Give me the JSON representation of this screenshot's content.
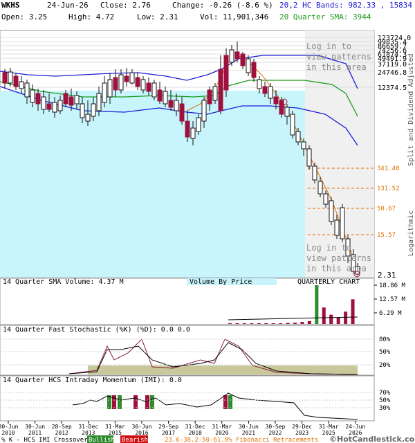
{
  "header": {
    "symbol": "WKHS",
    "date": "24-Jun-26",
    "close": "Close: 2.76",
    "change": "Change: -0.26 (-8.6 %)",
    "open": "Open: 3.25",
    "high": "High: 4.72",
    "low": "Low: 2.31",
    "vol": "Vol: 11,901,346",
    "bands": "20,2 HC Bands: 982.33 , 15834",
    "sma": "20 Quarter SMA: 3944"
  },
  "colors": {
    "up": "#2e8b2e",
    "down": "#a0103c",
    "bands": "#1a1ad6",
    "sma": "#1a9a1a",
    "vbp": "#c8f4fc",
    "fib": "#e07000",
    "stoch_band": "#c8c89a",
    "grey_region": "#f0f0f0",
    "watermark": "#8a8a8a"
  },
  "watermark": "Log in to view patterns in this area",
  "side_labels": {
    "split": "Split and Dividend Adjusted",
    "log": "Logarithmic"
  },
  "chart_data": {
    "type": "candlestick",
    "scale": "logarithmic",
    "price_ticks": [
      "123724.0",
      "99835.4",
      "86659.7",
      "74256.6",
      "61874.3",
      "49491.9",
      "37119.0",
      "24746.8",
      "12374.5"
    ],
    "fib_levels": [
      "341.40",
      "131.52",
      "50.67",
      "15.57"
    ],
    "last_price_label": "2.31",
    "volume_panel": {
      "title": "14 Quarter SMA Volume: 4.37 M",
      "vbp_label": "Volume By Price",
      "chart_label": "QUARTERLY CHART",
      "ticks": [
        "18.86 M",
        "12.57 M",
        "6.29 M"
      ],
      "bars": [
        0.2,
        0.15,
        0.25,
        0.2,
        0.2,
        0.3,
        0.3,
        0.3,
        0.5,
        0.6,
        1.0,
        1.4,
        18.86,
        8.0,
        4.5,
        3.2,
        6.0,
        12.0
      ]
    },
    "stochastic_panel": {
      "title": "14 Quarter Fast Stochastic (%K) (%D): 0.0 0.0",
      "ticks": [
        "80%",
        "50%",
        "20%"
      ]
    },
    "imi_panel": {
      "title": "14 Quarter HCS Intraday Momentum (IMI): 0.0",
      "ticks": [
        "70%",
        "50%",
        "30%"
      ]
    },
    "x_labels": [
      "30-Jun 2010",
      "30-Jun 2011",
      "28-Sep 2012",
      "31-Dec 2013",
      "31-Mar 2015",
      "30-Jun 2016",
      "29-Sep 2017",
      "31-Dec 2018",
      "31-Mar 2020",
      "30-Jun 2021",
      "30-Sep 2022",
      "29-Dec 2023",
      "31-Mar 2025",
      "24-Jun 2026"
    ]
  },
  "footer": {
    "prefix": "% K - HCS IMI Crossover:",
    "bullish": "Bullish",
    "bearish": "Bearish",
    "fib_text": "23.6-38.2-50-61.8% Fibonacci Retracements",
    "copyright": "©HotCandlestick.com"
  }
}
